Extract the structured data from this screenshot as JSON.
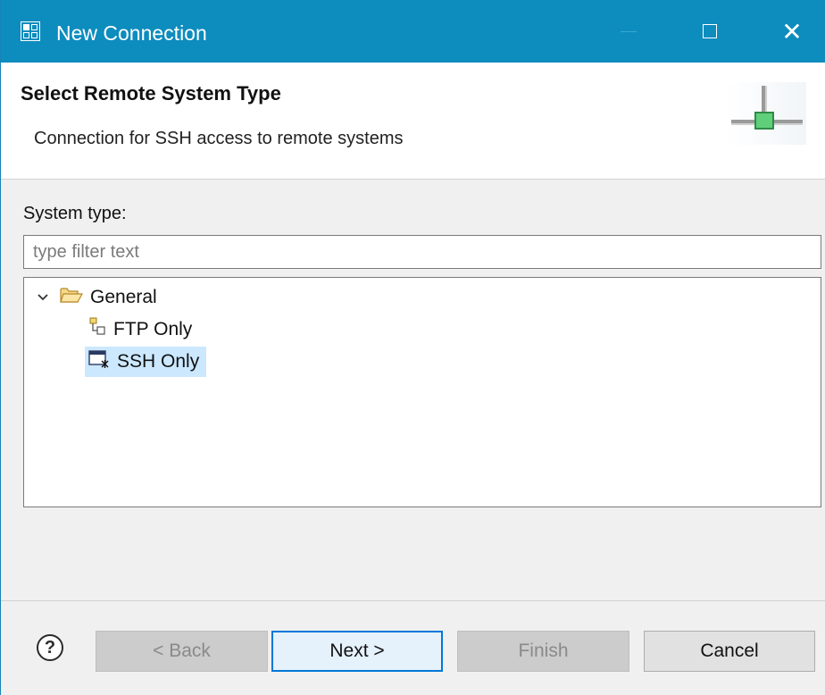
{
  "window": {
    "title": "New Connection",
    "controls": {
      "minimize": "",
      "maximize": "",
      "close": "✕"
    }
  },
  "header": {
    "title": "Select Remote System Type",
    "description": "Connection for SSH access to remote systems"
  },
  "body": {
    "system_type_label": "System type:",
    "filter": {
      "value": "",
      "placeholder": "type filter text"
    },
    "tree": {
      "group": {
        "label": "General",
        "expanded": true,
        "icon": "folder-open-icon"
      },
      "items": [
        {
          "label": "FTP Only",
          "icon": "ftp-connection-icon",
          "selected": false
        },
        {
          "label": "SSH Only",
          "icon": "ssh-terminal-icon",
          "selected": true
        }
      ]
    }
  },
  "footer": {
    "help": "?",
    "back": "< Back",
    "next": "Next >",
    "finish": "Finish",
    "cancel": "Cancel"
  },
  "colors": {
    "titlebar": "#0d8cbe",
    "selection": "#cce8ff",
    "default_button_border": "#0078d7",
    "connector_green": "#3aa35a"
  }
}
